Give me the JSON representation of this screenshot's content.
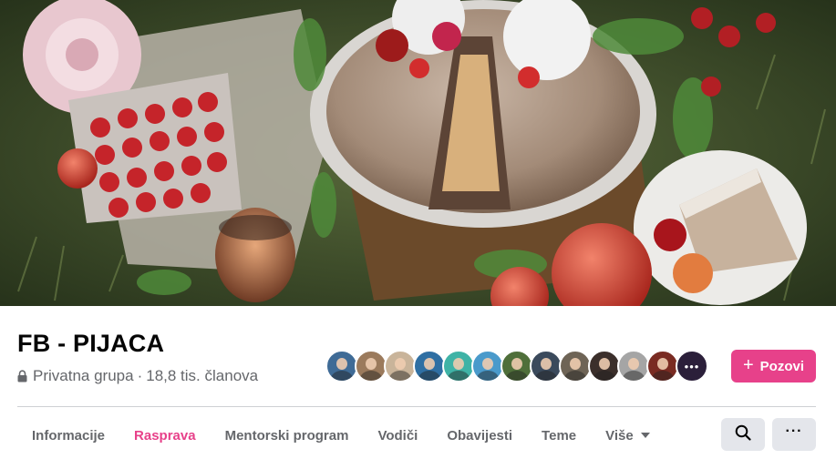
{
  "group": {
    "name": "FB - PIJACA",
    "privacy": "Privatna grupa",
    "separator": "·",
    "members": "18,8 tis. članova"
  },
  "cover_photo": {
    "description_icon": "cake-picnic-photo"
  },
  "member_avatars": {
    "count_shown": 13,
    "more_indicator": "•••",
    "colors": [
      "#3f6b96",
      "#9b7a5c",
      "#c9b49a",
      "#2f6fa3",
      "#3fb3a6",
      "#4a9acb",
      "#4f6f3a",
      "#3b4a5c",
      "#6e6456",
      "#3b2f2b",
      "#a5a5a5",
      "#7a2b22",
      "#2b1f3a"
    ]
  },
  "actions": {
    "invite_label": "Pozovi",
    "invite_icon": "plus-icon"
  },
  "tabs": [
    {
      "label": "Informacije",
      "active": false
    },
    {
      "label": "Rasprava",
      "active": true
    },
    {
      "label": "Mentorski program",
      "active": false
    },
    {
      "label": "Vodiči",
      "active": false
    },
    {
      "label": "Obavijesti",
      "active": false
    },
    {
      "label": "Teme",
      "active": false
    },
    {
      "label": "Više",
      "active": false
    }
  ],
  "toolbar": {
    "search_icon": "search-icon",
    "more_icon": "more-horizontal-icon",
    "more_label": "···"
  },
  "colors": {
    "accent": "#e7418a",
    "secondary_text": "#65676b",
    "button_grey": "#e4e6eb"
  }
}
